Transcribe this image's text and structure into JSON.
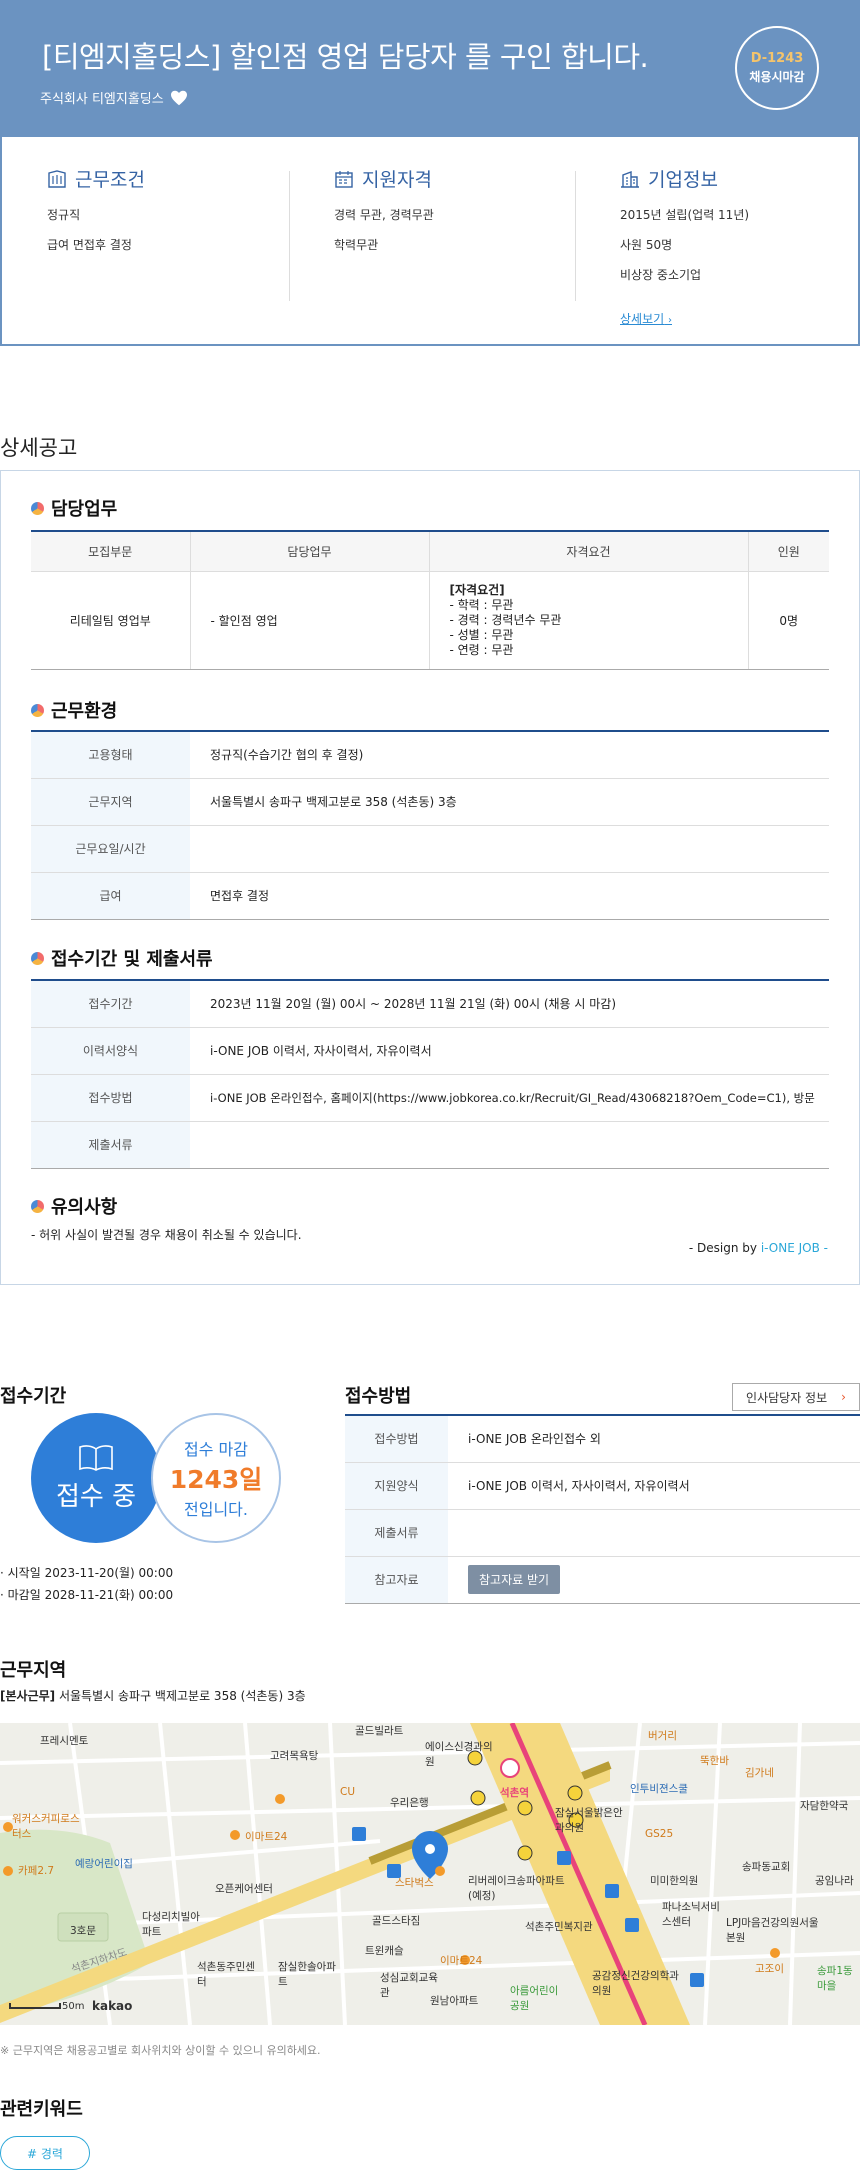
{
  "header": {
    "title": "[티엠지홀딩스] 할인점 영업 담당자 를 구인 합니다.",
    "company": "주식회사 티엠지홀딩스",
    "dday": "D-1243",
    "deadline_type": "채용시마감"
  },
  "summary": {
    "conditions": {
      "title": "근무조건",
      "items": [
        "정규직",
        "급여 면접후 결정"
      ]
    },
    "qualifications": {
      "title": "지원자격",
      "items": [
        "경력 무관, 경력무관",
        "학력무관"
      ]
    },
    "company": {
      "title": "기업정보",
      "items": [
        "2015년 설립(업력 11년)",
        "사원 50명",
        "비상장 중소기업"
      ],
      "link": "상세보기"
    }
  },
  "detail": {
    "section_title": "상세공고",
    "duty": {
      "title": "담당업무",
      "headers": [
        "모집부문",
        "담당업무",
        "자격요건",
        "인원"
      ],
      "row": {
        "dept": "리테일팀 영업부",
        "task": "- 할인점 영업",
        "req_title": "[자격요건]",
        "req_items": [
          "- 학력 : 무관",
          "- 경력 : 경력년수 무관",
          "- 성별 : 무관",
          "- 연령 : 무관"
        ],
        "count": "0명"
      }
    },
    "env": {
      "title": "근무환경",
      "rows": [
        {
          "k": "고용형태",
          "v": "정규직(수습기간 협의 후 결정)"
        },
        {
          "k": "근무지역",
          "v": "서울특별시 송파구 백제고분로 358 (석촌동) 3층"
        },
        {
          "k": "근무요일/시간",
          "v": ""
        },
        {
          "k": "급여",
          "v": "면접후 결정"
        }
      ]
    },
    "period": {
      "title": "접수기간 및 제출서류",
      "rows": [
        {
          "k": "접수기간",
          "v": "2023년 11월 20일 (월) 00시 ~ 2028년 11월 21일 (화) 00시 (채용 시 마감)"
        },
        {
          "k": "이력서양식",
          "v": "i-ONE JOB 이력서, 자사이력서, 자유이력서"
        },
        {
          "k": "접수방법",
          "v": "i-ONE JOB 온라인접수, 홈페이지(https://www.jobkorea.co.kr/Recruit/GI_Read/43068218?Oem_Code=C1), 방문"
        },
        {
          "k": "제출서류",
          "v": ""
        }
      ]
    },
    "caution": {
      "title": "유의사항",
      "text": "- 허위 사실이 발견될 경우 채용이 취소될 수 있습니다."
    },
    "design_prefix": "- Design by ",
    "design_brand": "i-ONE JOB -"
  },
  "receipt": {
    "title": "접수기간",
    "status": "접수 중",
    "remain_a": "접수 마감",
    "remain_days": "1243일",
    "remain_c": "전입니다.",
    "start": "시작일 2023-11-20(월) 00:00",
    "end": "마감일 2028-11-21(화) 00:00"
  },
  "method": {
    "title": "접수방법",
    "hr_button": "인사담당자 정보",
    "rows": [
      {
        "k": "접수방법",
        "v": "i-ONE JOB 온라인접수 외"
      },
      {
        "k": "지원양식",
        "v": "i-ONE JOB 이력서, 자사이력서, 자유이력서"
      },
      {
        "k": "제출서류",
        "v": ""
      },
      {
        "k": "참고자료",
        "v": ""
      }
    ],
    "ref_button": "참고자료 받기"
  },
  "location": {
    "title": "근무지역",
    "tag": "[본사근무]",
    "address": "서울특별시 송파구 백제고분로 358 (석촌동) 3층",
    "note": "※ 근무지역은 채용공고별로 회사위치와 상이할 수 있으니 유의하세요."
  },
  "map": {
    "scale": "50m",
    "brand": "kakao",
    "labels": [
      "프레시멘토",
      "고려목욕탕",
      "골드빌라트",
      "에이스신경과의원",
      "석촌역",
      "버거리",
      "뚝한바",
      "김가네",
      "인투비젼스쿨",
      "자담한약국",
      "워커스커피로스터스",
      "카페2.7",
      "이마트24",
      "우리은행",
      "잠실서울밝은안과의원",
      "GS25",
      "예랑어린이집",
      "오픈케어센터",
      "스타벅스",
      "리버레이크송파아파트(예정)",
      "미미한의원",
      "송파동교회",
      "공임나라",
      "다성리치빌아파트",
      "골드스타짐",
      "파나소닉서비스센터",
      "LPJ마음건강의원서울본원",
      "3호문",
      "석촌주민복지관",
      "트윈캐슬",
      "이마트24",
      "고조이",
      "석촌동주민센터",
      "잠실한솔아파트",
      "성심교회교육관",
      "원남아파트",
      "공감정신건강의학과의원",
      "송파1동마을",
      "아름어린이공원",
      "CU",
      "석촌지하차도"
    ]
  },
  "keywords": {
    "title": "관련키워드",
    "items": [
      "# 경력"
    ]
  }
}
